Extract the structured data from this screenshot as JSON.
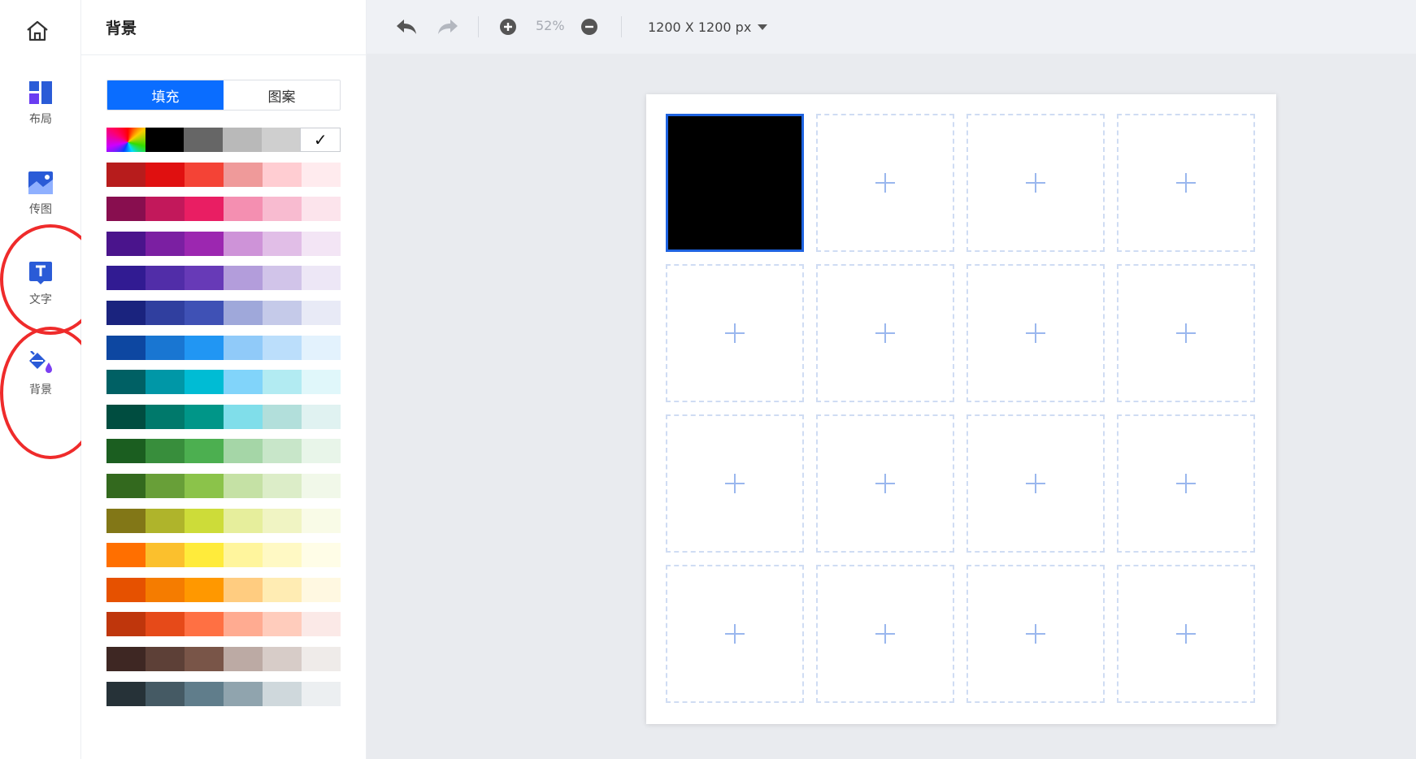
{
  "nav": {
    "home_icon": "home-icon",
    "items": [
      {
        "label": "布局",
        "icon": "layout-icon"
      },
      {
        "label": "传图",
        "icon": "image-upload-icon"
      },
      {
        "label": "文字",
        "icon": "text-icon"
      },
      {
        "label": "背景",
        "icon": "paint-bucket-icon"
      }
    ]
  },
  "panel": {
    "title": "背景",
    "tabs": [
      {
        "label": "填充",
        "active": true
      },
      {
        "label": "图案",
        "active": false
      }
    ],
    "palette_first_row": [
      "rainbow",
      "#000000",
      "#666666",
      "#b9b9b9",
      "#cfcfcf",
      "none"
    ],
    "palette_rows": [
      [
        "#b71c1c",
        "#e01010",
        "#f44336",
        "#ef9a9a",
        "#ffcdd2",
        "#ffebee"
      ],
      [
        "#880e4f",
        "#c2185b",
        "#e91e63",
        "#f48fb1",
        "#f8bbd0",
        "#fce4ec"
      ],
      [
        "#4a148c",
        "#7b1fa2",
        "#9c27b0",
        "#ce93d8",
        "#e1bee7",
        "#f3e5f5"
      ],
      [
        "#311b92",
        "#512da8",
        "#673ab7",
        "#b39ddb",
        "#d1c4e9",
        "#ede7f6"
      ],
      [
        "#1a237e",
        "#303f9f",
        "#3f51b5",
        "#9fa8da",
        "#c5cae9",
        "#e8eaf6"
      ],
      [
        "#0d47a1",
        "#1976d2",
        "#2196f3",
        "#90caf9",
        "#bbdefb",
        "#e3f2fd"
      ],
      [
        "#006064",
        "#0097a7",
        "#00bcd4",
        "#81d4fa",
        "#b2ebf2",
        "#e0f7fa"
      ],
      [
        "#004d40",
        "#00796b",
        "#009688",
        "#80deea",
        "#b2dfdb",
        "#e0f2f1"
      ],
      [
        "#1b5e20",
        "#388e3c",
        "#4caf50",
        "#a5d6a7",
        "#c8e6c9",
        "#e8f5e9"
      ],
      [
        "#33691e",
        "#689f38",
        "#8bc34a",
        "#c5e1a5",
        "#dcedc8",
        "#f1f8e9"
      ],
      [
        "#827717",
        "#afb42b",
        "#cddc39",
        "#e6ee9c",
        "#f0f4c3",
        "#f9fbe7"
      ],
      [
        "#ff6f00",
        "#fbc02d",
        "#ffeb3b",
        "#fff59d",
        "#fff9c4",
        "#fffde7"
      ],
      [
        "#e65100",
        "#f57c00",
        "#ff9800",
        "#ffcc80",
        "#ffecb3",
        "#fff8e1"
      ],
      [
        "#bf360c",
        "#e64a19",
        "#ff7043",
        "#ffab91",
        "#ffccbc",
        "#fbe9e7"
      ],
      [
        "#3e2723",
        "#5d4037",
        "#795548",
        "#bcaaa4",
        "#d7ccc8",
        "#efebe9"
      ],
      [
        "#263238",
        "#455a64",
        "#607d8b",
        "#90a4ae",
        "#cfd8dc",
        "#eceff1"
      ]
    ]
  },
  "toolbar": {
    "undo_icon": "undo-icon",
    "redo_icon": "redo-icon",
    "zoom_in_icon": "zoom-in-icon",
    "zoom_out_icon": "zoom-out-icon",
    "zoom_level": "52%",
    "canvas_size": "1200 X 1200 px"
  },
  "canvas": {
    "rows": 4,
    "cols": 4,
    "filled_cells": [
      0
    ],
    "filled_color": "#000000",
    "selected_border_color": "#1f63e0"
  },
  "colors": {
    "accent": "#0a6dff",
    "nav_icon_blue": "#2a5bd7",
    "annotation_red": "#ef2b2b"
  }
}
